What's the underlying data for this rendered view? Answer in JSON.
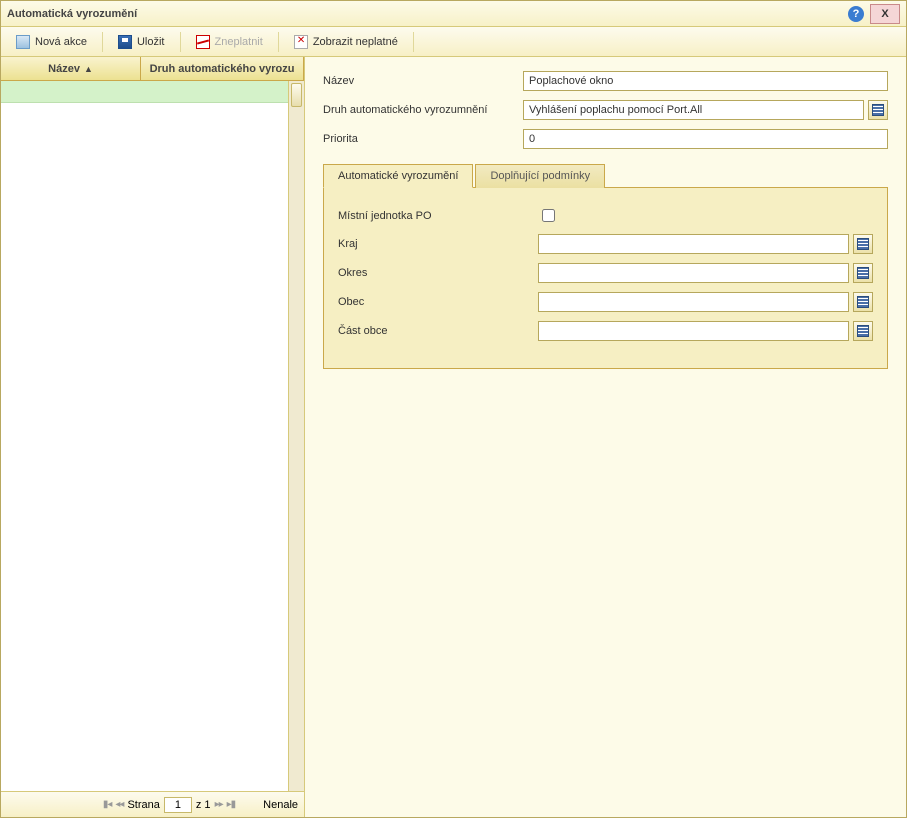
{
  "window": {
    "title": "Automatická vyrozumění"
  },
  "title_buttons": {
    "help": "?",
    "close": "X"
  },
  "toolbar": {
    "new": "Nová akce",
    "save": "Uložit",
    "invalidate": "Zneplatnit",
    "show_invalid": "Zobrazit neplatné"
  },
  "grid": {
    "col1": "Název",
    "col2": "Druh automatického vyrozu",
    "sort": "▲"
  },
  "pager": {
    "strana": "Strana",
    "page": "1",
    "z": "z 1",
    "status": "Nenale"
  },
  "form": {
    "nazev_label": "Název",
    "nazev_value": "Poplachové okno",
    "druh_label": "Druh automatického vyrozumnění",
    "druh_value": "Vyhlášení poplachu pomocí Port.All",
    "priorita_label": "Priorita",
    "priorita_value": "0"
  },
  "tabs": {
    "tab1": "Automatické vyrozumění",
    "tab2": "Doplňující podmínky"
  },
  "panel": {
    "mj_label": "Místní jednotka PO",
    "kraj_label": "Kraj",
    "okres_label": "Okres",
    "obec_label": "Obec",
    "cast_label": "Část obce",
    "kraj_value": "",
    "okres_value": "",
    "obec_value": "",
    "cast_value": ""
  }
}
